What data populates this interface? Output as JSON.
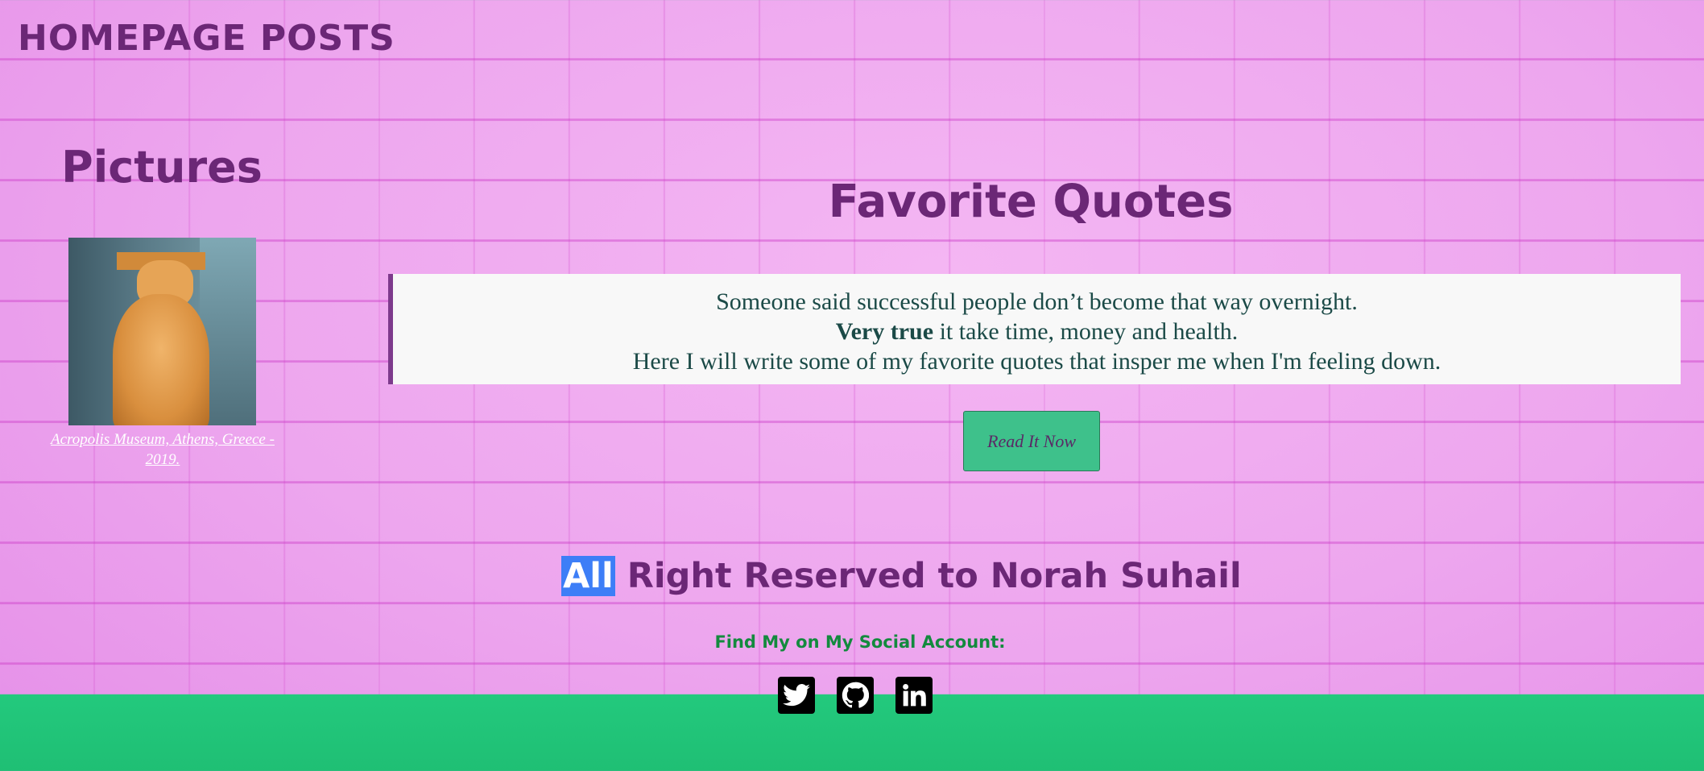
{
  "header": {
    "title": "HOMEPAGE POSTS"
  },
  "pictures": {
    "heading": "Pictures",
    "caption": "Acropolis Museum, Athens, Greece - 2019."
  },
  "quotes": {
    "heading": "Favorite Quotes",
    "line1": "Someone said successful people don’t become that way overnight.",
    "line2_bold": "Very true",
    "line2_rest": " it take time, money and health.",
    "line3": "Here I will write some of my favorite quotes that insper me when I'm feeling down.",
    "button_label": "Read It Now"
  },
  "footer": {
    "rights_selected": "All",
    "rights_rest": " Right Reserved to Norah Suhail",
    "social_text": "Find My on My Social Account:",
    "icons": [
      "twitter-icon",
      "github-icon",
      "linkedin-icon"
    ]
  },
  "colors": {
    "heading": "#6b2776",
    "button": "#3ec18b",
    "bottom_band": "#23c97d",
    "selection": "#3d7ef7"
  }
}
